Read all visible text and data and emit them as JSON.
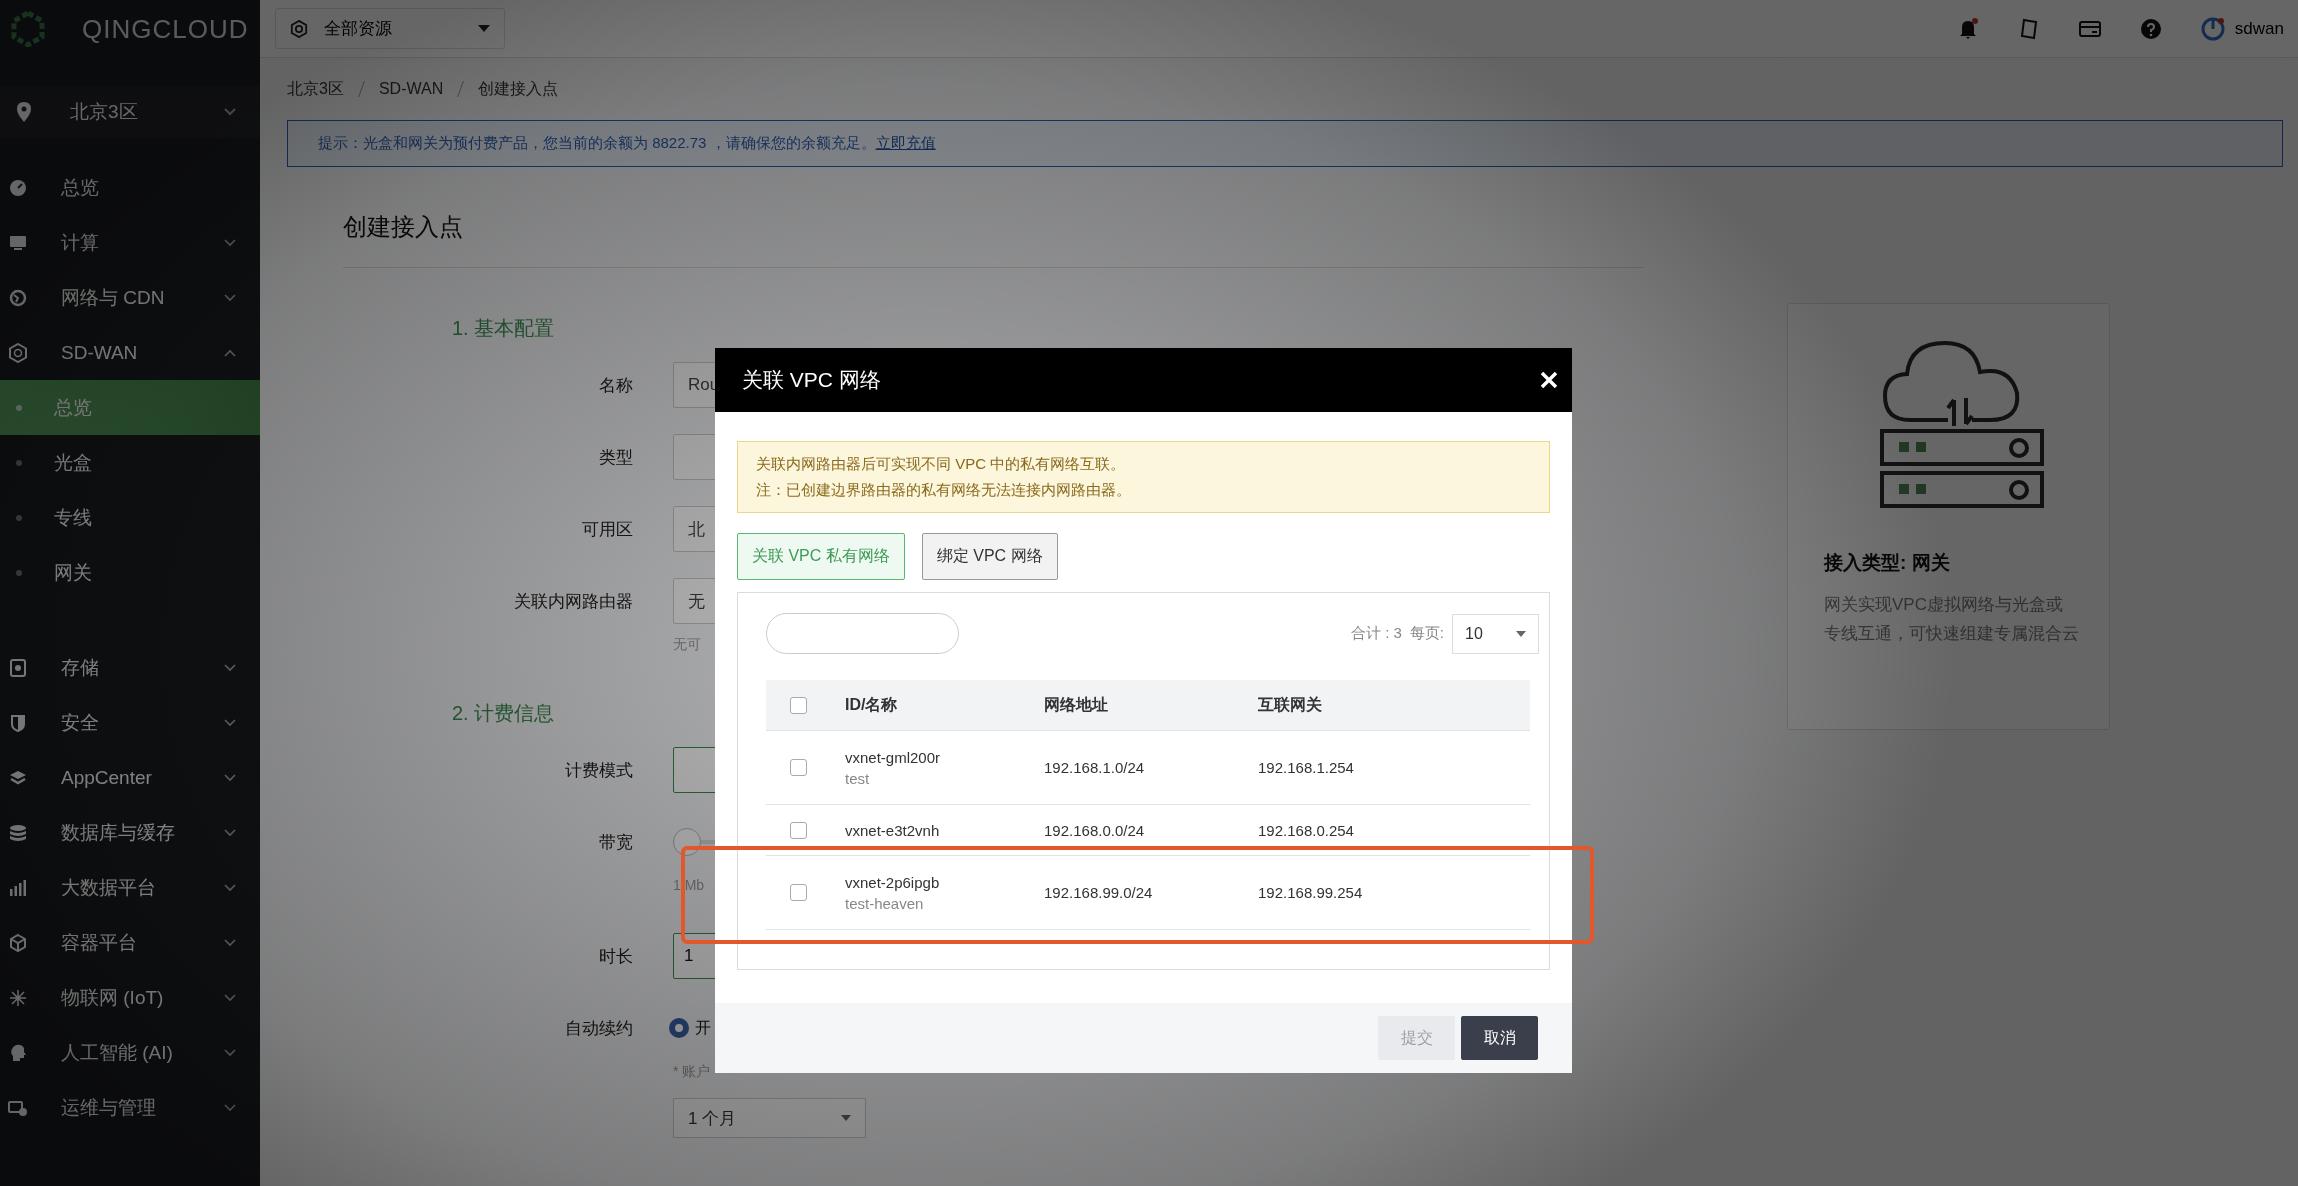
{
  "logo": {
    "text": "QINGCLOUD"
  },
  "sidebar": {
    "region": "北京3区",
    "items": [
      {
        "label": "总览",
        "kind": "link"
      },
      {
        "label": "计算",
        "kind": "group",
        "expanded": false
      },
      {
        "label": "网络与 CDN",
        "kind": "group",
        "expanded": false
      },
      {
        "label": "SD-WAN",
        "kind": "group",
        "expanded": true,
        "children": [
          {
            "label": "总览",
            "selected": true
          },
          {
            "label": "光盒",
            "selected": false
          },
          {
            "label": "专线",
            "selected": false
          },
          {
            "label": "网关",
            "selected": false
          }
        ]
      },
      {
        "label": "存储",
        "kind": "group",
        "expanded": false
      },
      {
        "label": "安全",
        "kind": "group",
        "expanded": false
      },
      {
        "label": "AppCenter",
        "kind": "group",
        "expanded": false
      },
      {
        "label": "数据库与缓存",
        "kind": "group",
        "expanded": false
      },
      {
        "label": "大数据平台",
        "kind": "group",
        "expanded": false
      },
      {
        "label": "容器平台",
        "kind": "group",
        "expanded": false
      },
      {
        "label": "物联网 (IoT)",
        "kind": "group",
        "expanded": false
      },
      {
        "label": "人工智能 (AI)",
        "kind": "group",
        "expanded": false
      },
      {
        "label": "运维与管理",
        "kind": "group",
        "expanded": false
      }
    ]
  },
  "topbar": {
    "resource_selector": "全部资源",
    "user": "sdwan"
  },
  "breadcrumb": [
    "北京3区",
    "SD-WAN",
    "创建接入点"
  ],
  "notice": {
    "text": "提示：光盒和网关为预付费产品，您当前的余额为 8822.73 ，请确保您的余额充足。",
    "link": "立即充值"
  },
  "page_title": "创建接入点",
  "sections": [
    {
      "title": "1. 基本配置",
      "fields": [
        {
          "label": "名称",
          "kind": "input",
          "value": "Rou"
        },
        {
          "label": "类型",
          "kind": "input"
        },
        {
          "label": "可用区",
          "kind": "input",
          "value": "北"
        },
        {
          "label": "关联内网路由器",
          "kind": "input",
          "value": "无",
          "hint": "无可"
        }
      ]
    },
    {
      "title": "2. 计费信息",
      "fields": [
        {
          "label": "计费模式",
          "kind": "segment"
        },
        {
          "label": "带宽",
          "kind": "slider",
          "level": 0,
          "hint": "1 Mb"
        },
        {
          "label": "时长",
          "kind": "segment",
          "value": "1"
        },
        {
          "label": "自动续约",
          "kind": "radio",
          "value": "开",
          "checked": true,
          "hint": "* 账户",
          "select": "1 个月"
        }
      ]
    }
  ],
  "type_card": {
    "title": "接入类型: 网关",
    "description": "网关实现VPC虚拟网络与光盒或专线互通，可快速组建专属混合云"
  },
  "modal": {
    "title": "关联 VPC 网络",
    "alert": [
      "关联内网路由器后可实现不同 VPC 中的私有网络互联。",
      "注：已创建边界路由器的私有网络无法连接内网路由器。"
    ],
    "tabs": [
      {
        "label": "关联 VPC 私有网络",
        "selected": true
      },
      {
        "label": "绑定 VPC 网络",
        "selected": false
      }
    ],
    "total": "合计 : 3",
    "per_page_label": "每页:",
    "per_page": "10",
    "all_checked": false,
    "columns": [
      "ID/名称",
      "网络地址",
      "互联网关"
    ],
    "rows": [
      {
        "id": "vxnet-gml200r",
        "name": "test",
        "address": "192.168.1.0/24",
        "gateway": "192.168.1.254",
        "checked": false,
        "annotated": false
      },
      {
        "id": "vxnet-e3t2vnh",
        "address": "192.168.0.0/24",
        "gateway": "192.168.0.254",
        "checked": false,
        "annotated": false
      },
      {
        "id": "vxnet-2p6ipgb",
        "name": "test-heaven",
        "address": "192.168.99.0/24",
        "gateway": "192.168.99.254",
        "checked": false,
        "annotated": true
      }
    ],
    "buttons": [
      {
        "label": "提交",
        "kind": "submit",
        "disabled": true
      },
      {
        "label": "取消",
        "kind": "cancel",
        "disabled": false
      }
    ]
  }
}
